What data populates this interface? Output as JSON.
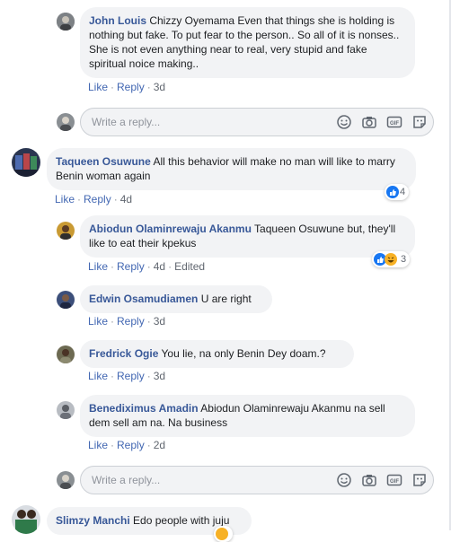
{
  "reply_placeholder": "Write a reply...",
  "actions": {
    "like": "Like",
    "reply": "Reply",
    "sep": "·",
    "edited": "Edited"
  },
  "comments": [
    {
      "author": "John Louis",
      "text": "Chizzy Oyemama Even that things she is holding is nothing but fake. To put fear to the person.. So all of it is nonses.. She is not even anything near to real, very stupid and fake spiritual noice making..",
      "time": "3d"
    },
    {
      "author": "Taqueen Osuwune",
      "text": "All this behavior will make no man will like to marry Benin woman again",
      "time": "4d",
      "reactions": {
        "count": "4",
        "icons": [
          "like-icon"
        ]
      }
    },
    {
      "author": "Abiodun Olaminrewaju Akanmu",
      "text": "Taqueen Osuwune but, they'll like to eat their kpekus",
      "time": "4d",
      "edited": true,
      "reactions": {
        "count": "3",
        "icons": [
          "like-icon",
          "haha-icon"
        ]
      }
    },
    {
      "author": "Edwin Osamudiamen",
      "text": "U are right",
      "time": "3d"
    },
    {
      "author": "Fredrick Ogie",
      "text": "You lie, na only Benin Dey doam.?",
      "time": "3d"
    },
    {
      "author": "Benediximus Amadin",
      "text": "Abiodun Olaminrewaju Akanmu na sell dem sell am na. Na business",
      "time": "2d"
    },
    {
      "author": "Slimzy Manchi",
      "text": "Edo people with juju"
    }
  ],
  "colors": {
    "link": "#385898",
    "action": "#4267b2",
    "bubble": "#f2f3f5",
    "like": "#1877f2",
    "haha": "#f7b125"
  }
}
